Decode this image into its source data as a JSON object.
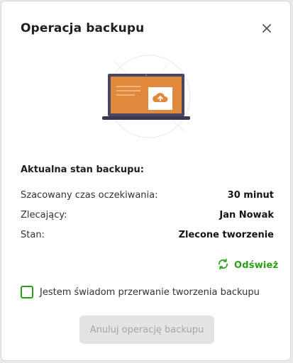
{
  "dialog": {
    "title": "Operacja backupu",
    "close_icon": "close-icon"
  },
  "illustration": {
    "icon": "laptop-cloud-upload-icon",
    "colors": {
      "screen": "#e0883b",
      "frame": "#4a4660",
      "card": "#ffffff"
    }
  },
  "status": {
    "heading": "Aktualna stan backupu:",
    "rows": [
      {
        "label": "Szacowany czas oczekiwania:",
        "value": "30 minut"
      },
      {
        "label": "Zlecający:",
        "value": "Jan Nowak"
      },
      {
        "label": "Stan:",
        "value": "Zlecone tworzenie"
      }
    ]
  },
  "refresh": {
    "label": "Odśwież",
    "icon": "refresh-icon",
    "color": "#2aa017"
  },
  "acknowledge": {
    "label": "Jestem świadom przerwanie tworzenia backupu",
    "checked": false
  },
  "cancel_button": {
    "label": "Anuluj operację backupu",
    "disabled": true
  }
}
